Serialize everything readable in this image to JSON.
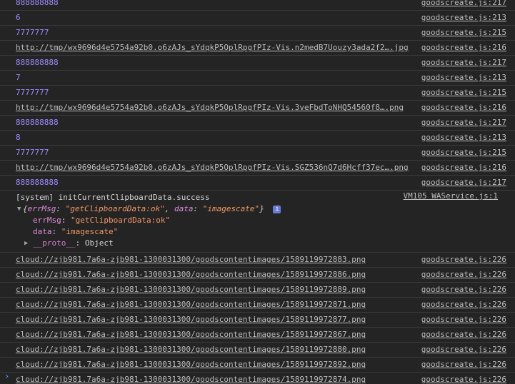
{
  "rows_top": [
    {
      "text": "888888888",
      "kind": "num",
      "source": "goodscreate.js:217"
    },
    {
      "text": "6",
      "kind": "num",
      "source": "goodscreate.js:213"
    },
    {
      "text": "7777777",
      "kind": "num",
      "source": "goodscreate.js:215"
    },
    {
      "text": "http://tmp/wx9696d4e5754a92b0.o6zAJs_sYdqkP5OplRpgfPIz-Vis.n2medB7Uouzy3ada2f2….jpg",
      "kind": "link",
      "source": "goodscreate.js:216"
    },
    {
      "text": "888888888",
      "kind": "num",
      "source": "goodscreate.js:217"
    },
    {
      "text": "7",
      "kind": "num",
      "source": "goodscreate.js:213"
    },
    {
      "text": "7777777",
      "kind": "num",
      "source": "goodscreate.js:215"
    },
    {
      "text": "http://tmp/wx9696d4e5754a92b0.o6zAJs_sYdqkP5OplRpgfPIz-Vis.3veFbdToNHQ54560f8….png",
      "kind": "link",
      "source": "goodscreate.js:216"
    },
    {
      "text": "888888888",
      "kind": "num",
      "source": "goodscreate.js:217"
    },
    {
      "text": "8",
      "kind": "num",
      "source": "goodscreate.js:213"
    },
    {
      "text": "7777777",
      "kind": "num",
      "source": "goodscreate.js:215"
    },
    {
      "text": "http://tmp/wx9696d4e5754a92b0.o6zAJs_sYdqkP5OplRpgfPIz-Vis.SGZ536nQ7d6Hcff37ec….png",
      "kind": "link",
      "source": "goodscreate.js:216"
    },
    {
      "text": "888888888",
      "kind": "num",
      "source": "goodscreate.js:217"
    }
  ],
  "system_log": {
    "text": "[system] initCurrentClipboardData.success",
    "source": "VM105 WAService.js:1",
    "summary_open": "{",
    "summary_key1": "errMsg",
    "summary_val1": "\"getClipboardData:ok\"",
    "summary_sep": ", ",
    "summary_key2": "data",
    "summary_val2": "\"imagescate\"",
    "summary_close": "}",
    "info_badge": "i",
    "prop1_key": "errMsg",
    "prop1_val": "\"getClipboardData:ok\"",
    "prop2_key": "data",
    "prop2_val": "\"imagescate\"",
    "proto_key": "__proto__",
    "proto_val": "Object",
    "colon": ": "
  },
  "rows_bottom": [
    {
      "text": "cloud://zjb981.7a6a-zjb981-1300031300/goodscontentimages/1589119972883.png",
      "kind": "link",
      "source": "goodscreate.js:226"
    },
    {
      "text": "cloud://zjb981.7a6a-zjb981-1300031300/goodscontentimages/1589119972886.png",
      "kind": "link",
      "source": "goodscreate.js:226"
    },
    {
      "text": "cloud://zjb981.7a6a-zjb981-1300031300/goodscontentimages/1589119972889.png",
      "kind": "link",
      "source": "goodscreate.js:226"
    },
    {
      "text": "cloud://zjb981.7a6a-zjb981-1300031300/goodscontentimages/1589119972871.png",
      "kind": "link",
      "source": "goodscreate.js:226"
    },
    {
      "text": "cloud://zjb981.7a6a-zjb981-1300031300/goodscontentimages/1589119972877.png",
      "kind": "link",
      "source": "goodscreate.js:226"
    },
    {
      "text": "cloud://zjb981.7a6a-zjb981-1300031300/goodscontentimages/1589119972867.png",
      "kind": "link",
      "source": "goodscreate.js:226"
    },
    {
      "text": "cloud://zjb981.7a6a-zjb981-1300031300/goodscontentimages/1589119972880.png",
      "kind": "link",
      "source": "goodscreate.js:226"
    },
    {
      "text": "cloud://zjb981.7a6a-zjb981-1300031300/goodscontentimages/1589119972892.png",
      "kind": "link",
      "source": "goodscreate.js:226"
    },
    {
      "text": "cloud://zjb981.7a6a-zjb981-1300031300/goodscontentimages/1589119972874.png",
      "kind": "link",
      "source": "goodscreate.js:226"
    }
  ],
  "prompt_symbol": "›",
  "colors": {
    "background": "#242424",
    "number": "#9c8cff",
    "link": "#bdbdbd",
    "key": "#e08bdc",
    "string": "#f29766",
    "prompt": "#4aa3ff"
  }
}
